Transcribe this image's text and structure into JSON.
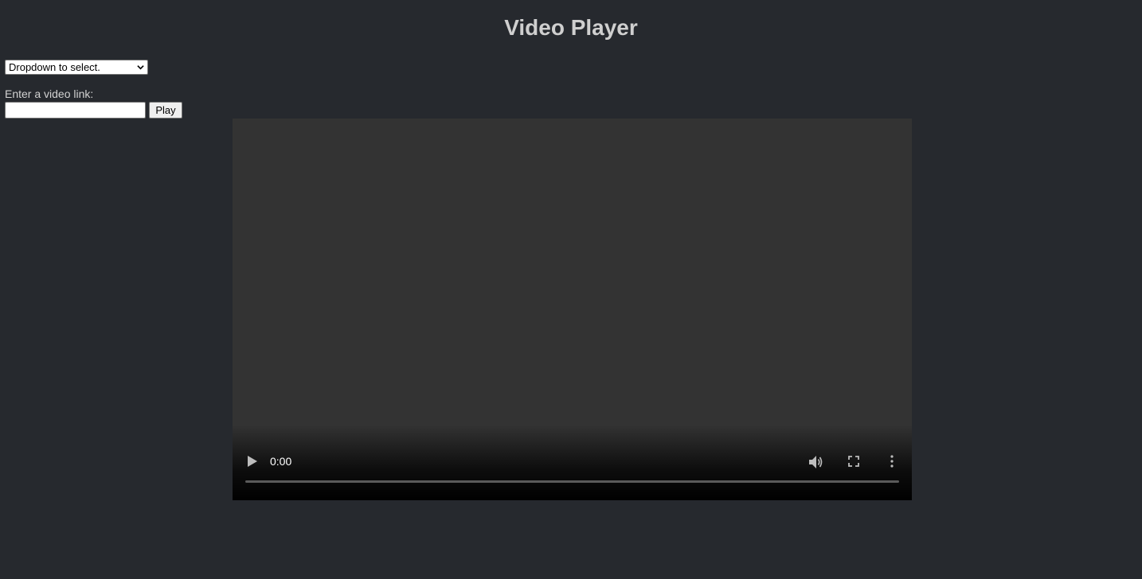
{
  "page": {
    "title": "Video Player"
  },
  "controls": {
    "select_value": "Dropdown to select.",
    "link_label": "Enter a video link:",
    "link_value": "",
    "link_placeholder": "",
    "play_label": "Play"
  },
  "video": {
    "time": "0:00",
    "progress": 0,
    "icons": [
      "play-icon",
      "volume-icon",
      "fullscreen-icon",
      "more-options-icon"
    ]
  },
  "colors": {
    "background": "#26292e",
    "video_area": "#333333",
    "title": "#cfcfcf"
  }
}
